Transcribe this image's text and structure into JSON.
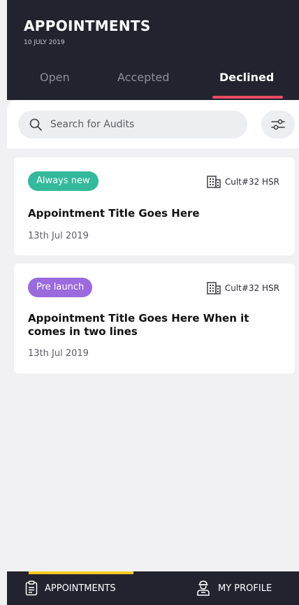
{
  "header": {
    "title": "APPOINTMENTS",
    "date": "10 JULY 2019"
  },
  "tabs": [
    {
      "label": "Open",
      "active": false
    },
    {
      "label": "Accepted",
      "active": false
    },
    {
      "label": "Declined",
      "active": true
    }
  ],
  "search": {
    "placeholder": "Search for Audits",
    "value": ""
  },
  "cards": [
    {
      "badge": "Always new",
      "badge_color": "#33b99b",
      "location": "Cult#32 HSR",
      "title": "Appointment Title Goes Here",
      "date": "13th Jul 2019"
    },
    {
      "badge": "Pre launch",
      "badge_color": "#9a6ade",
      "location": "Cult#32 HSR",
      "title": "Appointment Title Goes Here When it comes in two lines",
      "date": "13th Jul 2019"
    }
  ],
  "bottom_nav": {
    "appointments_label": "APPOINTMENTS",
    "profile_label": "MY PROFILE",
    "active": "appointments"
  },
  "colors": {
    "header_bg": "#22232f",
    "tab_indicator": "#ee4b63",
    "nav_indicator": "#f4ca1d"
  },
  "icons": {
    "search": "search-icon",
    "filter": "sliders-icon",
    "location": "building-icon",
    "appointments": "clipboard-icon",
    "profile": "user-icon"
  }
}
